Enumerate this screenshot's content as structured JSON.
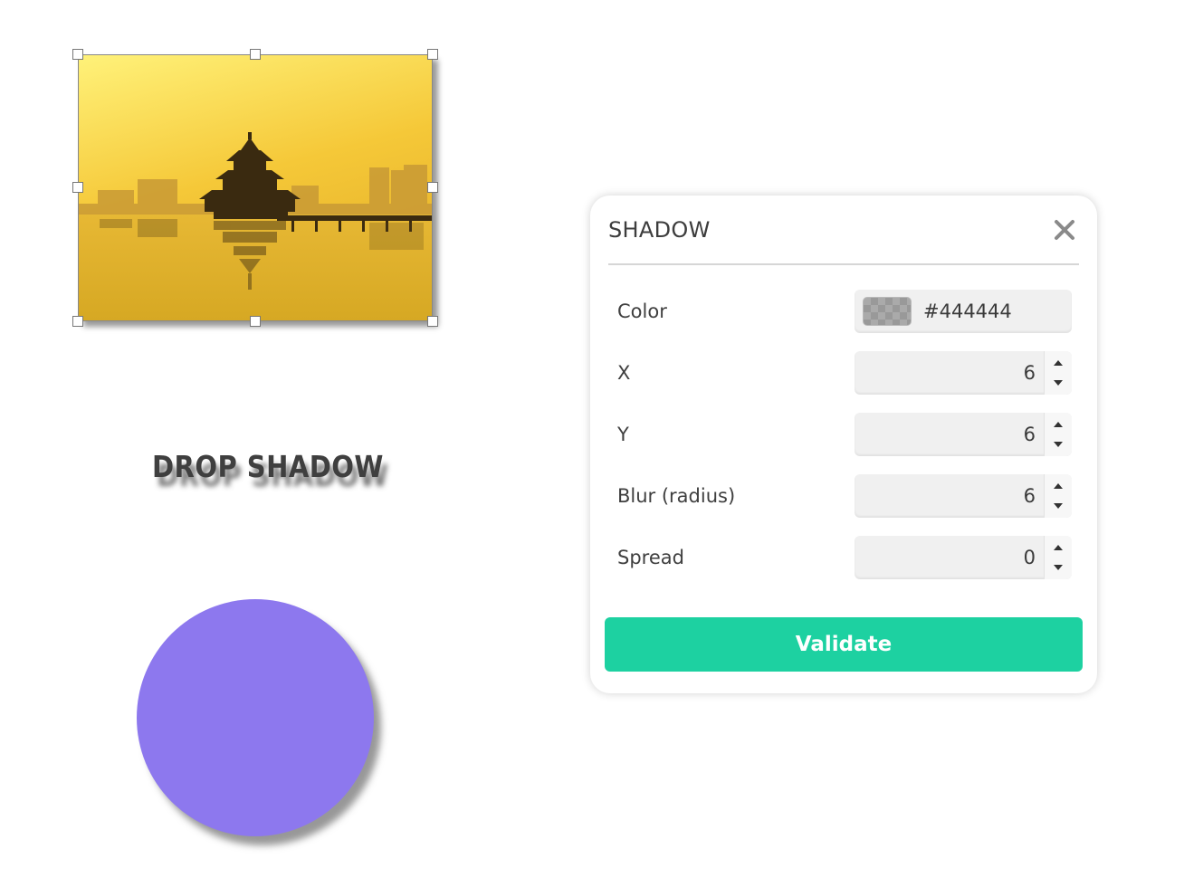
{
  "canvas": {
    "text_object": "DROP SHADOW",
    "circle_color": "#8d78ee",
    "image_description_icon": "pagoda-lake-photo"
  },
  "panel": {
    "title": "SHADOW",
    "close_icon": "close-icon",
    "fields": {
      "color": {
        "label": "Color",
        "value": "#444444"
      },
      "x": {
        "label": "X",
        "value": "6"
      },
      "y": {
        "label": "Y",
        "value": "6"
      },
      "blur": {
        "label": "Blur (radius)",
        "value": "6"
      },
      "spread": {
        "label": "Spread",
        "value": "0"
      }
    },
    "validate_label": "Validate",
    "accent_color": "#1dd1a1"
  }
}
